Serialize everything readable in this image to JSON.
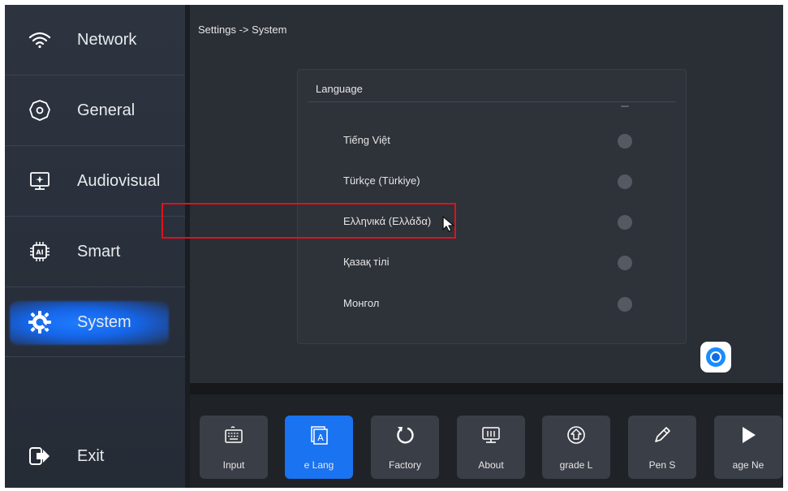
{
  "sidebar": {
    "items": [
      {
        "label": "Network",
        "icon": "wifi-icon"
      },
      {
        "label": "General",
        "icon": "settings-gear-icon"
      },
      {
        "label": "Audiovisual",
        "icon": "monitor-icon"
      },
      {
        "label": "Smart",
        "icon": "ai-chip-icon"
      },
      {
        "label": "System",
        "icon": "system-gear-icon",
        "active": true
      }
    ],
    "exit_label": "Exit"
  },
  "breadcrumb": "Settings -> System",
  "language_panel": {
    "title": "Language",
    "options": [
      {
        "label": "Tiếng Việt",
        "selected": false
      },
      {
        "label": "Türkçe (Türkiye)",
        "selected": false
      },
      {
        "label": "Ελληνικά (Ελλάδα)",
        "selected": false
      },
      {
        "label": "Қазақ тілі",
        "selected": false
      },
      {
        "label": "Монгол",
        "selected": false
      }
    ]
  },
  "bottom_bar": {
    "tiles": [
      {
        "label": "Input",
        "icon": "keyboard-icon"
      },
      {
        "label": "e   Lang",
        "icon": "language-icon",
        "active": true
      },
      {
        "label": "Factory",
        "icon": "reset-icon"
      },
      {
        "label": "About",
        "icon": "info-screen-icon"
      },
      {
        "label": "ɡrade    L",
        "icon": "upgrade-icon"
      },
      {
        "label": "Pen    S",
        "icon": "pen-icon"
      },
      {
        "label": "age    Ne",
        "icon": "play-icon"
      }
    ]
  },
  "colors": {
    "accent": "#1a73f0",
    "highlight": "#e0111b"
  }
}
